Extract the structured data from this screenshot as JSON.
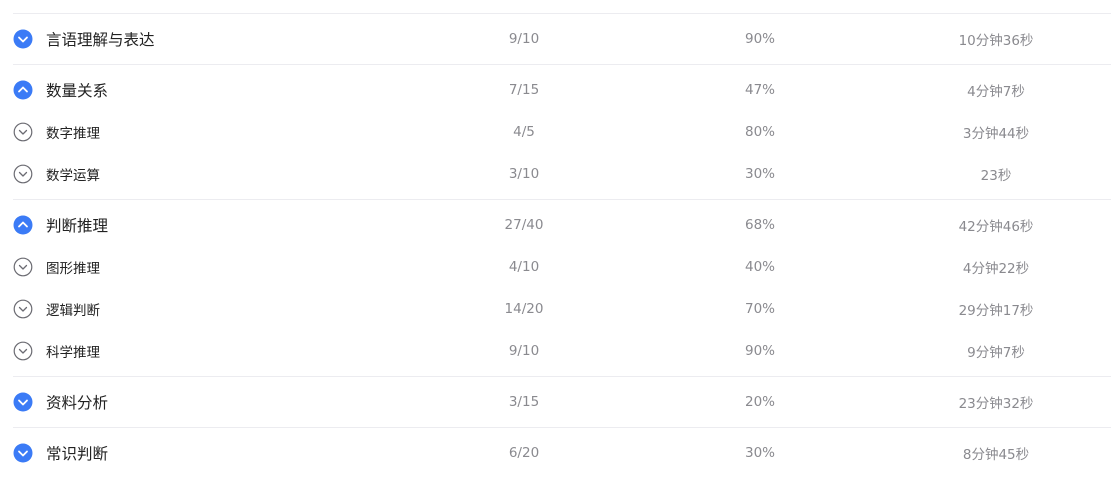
{
  "colors": {
    "accent": "#3b7bf6",
    "text_primary": "#222222",
    "text_secondary": "#8a8a8f",
    "divider": "#ececf0",
    "sub_icon_stroke": "#6b6b72"
  },
  "rows": [
    {
      "kind": "group",
      "icon": "chevron-down-icon",
      "name": "言语理解与表达",
      "score": "9/10",
      "rate": "90%",
      "time": "10分钟36秒"
    },
    {
      "kind": "group",
      "icon": "chevron-up-icon",
      "name": "数量关系",
      "score": "7/15",
      "rate": "47%",
      "time": "4分钟7秒"
    },
    {
      "kind": "sub",
      "icon": "chevron-down-outline-icon",
      "name": "数字推理",
      "score": "4/5",
      "rate": "80%",
      "time": "3分钟44秒"
    },
    {
      "kind": "sub",
      "icon": "chevron-down-outline-icon",
      "name": "数学运算",
      "score": "3/10",
      "rate": "30%",
      "time": "23秒"
    },
    {
      "kind": "group",
      "icon": "chevron-up-icon",
      "name": "判断推理",
      "score": "27/40",
      "rate": "68%",
      "time": "42分钟46秒"
    },
    {
      "kind": "sub",
      "icon": "chevron-down-outline-icon",
      "name": "图形推理",
      "score": "4/10",
      "rate": "40%",
      "time": "4分钟22秒"
    },
    {
      "kind": "sub",
      "icon": "chevron-down-outline-icon",
      "name": "逻辑判断",
      "score": "14/20",
      "rate": "70%",
      "time": "29分钟17秒"
    },
    {
      "kind": "sub",
      "icon": "chevron-down-outline-icon",
      "name": "科学推理",
      "score": "9/10",
      "rate": "90%",
      "time": "9分钟7秒"
    },
    {
      "kind": "group",
      "icon": "chevron-down-icon",
      "name": "资料分析",
      "score": "3/15",
      "rate": "20%",
      "time": "23分钟32秒"
    },
    {
      "kind": "group",
      "icon": "chevron-down-icon",
      "name": "常识判断",
      "score": "6/20",
      "rate": "30%",
      "time": "8分钟45秒"
    }
  ]
}
